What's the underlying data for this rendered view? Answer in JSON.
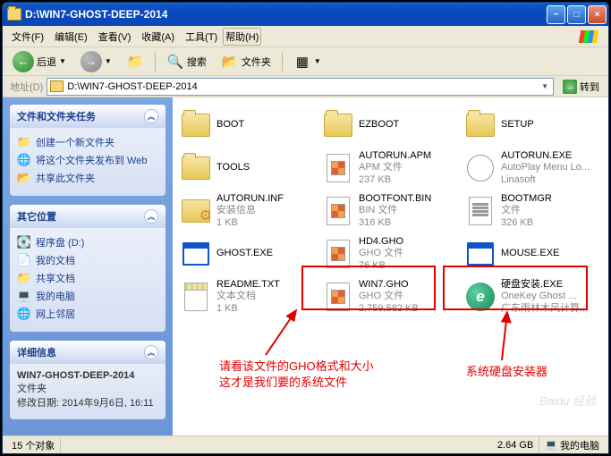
{
  "window": {
    "title": "D:\\WIN7-GHOST-DEEP-2014"
  },
  "menu": {
    "file": "文件(F)",
    "edit": "编辑(E)",
    "view": "查看(V)",
    "favorites": "收藏(A)",
    "tools": "工具(T)",
    "help": "帮助(H)"
  },
  "toolbar": {
    "back": "后退",
    "search": "搜索",
    "folders": "文件夹"
  },
  "address": {
    "label": "地址(D)",
    "value": "D:\\WIN7-GHOST-DEEP-2014",
    "go": "转到"
  },
  "sidebar": {
    "tasks": {
      "title": "文件和文件夹任务",
      "items": [
        {
          "label": "创建一个新文件夹"
        },
        {
          "label": "将这个文件夹发布到 Web"
        },
        {
          "label": "共享此文件夹"
        }
      ]
    },
    "places": {
      "title": "其它位置",
      "items": [
        {
          "label": "程序盘 (D:)"
        },
        {
          "label": "我的文档"
        },
        {
          "label": "共享文档"
        },
        {
          "label": "我的电脑"
        },
        {
          "label": "网上邻居"
        }
      ]
    },
    "details": {
      "title": "详细信息",
      "name": "WIN7-GHOST-DEEP-2014",
      "type": "文件夹",
      "modified_label": "修改日期:",
      "modified_value": "2014年9月6日, 16:11"
    }
  },
  "files": [
    {
      "name": "BOOT",
      "icon": "folder"
    },
    {
      "name": "EZBOOT",
      "icon": "folder"
    },
    {
      "name": "SETUP",
      "icon": "folder"
    },
    {
      "name": "TOOLS",
      "icon": "folder"
    },
    {
      "name": "AUTORUN.APM",
      "meta1": "APM 文件",
      "meta2": "237 KB",
      "icon": "gho"
    },
    {
      "name": "AUTORUN.EXE",
      "meta1": "AutoPlay Menu Lo...",
      "meta2": "Linasoft",
      "icon": "cd"
    },
    {
      "name": "AUTORUN.INF",
      "meta1": "安装信息",
      "meta2": "1 KB",
      "icon": "gear"
    },
    {
      "name": "BOOTFONT.BIN",
      "meta1": "BIN 文件",
      "meta2": "316 KB",
      "icon": "gho"
    },
    {
      "name": "BOOTMGR",
      "meta1": "文件",
      "meta2": "326 KB",
      "icon": "doc"
    },
    {
      "name": "GHOST.EXE",
      "icon": "exe"
    },
    {
      "name": "HD4.GHO",
      "meta1": "GHO 文件",
      "meta2": "76 KB",
      "icon": "gho"
    },
    {
      "name": "MOUSE.EXE",
      "icon": "exe"
    },
    {
      "name": "README.TXT",
      "meta1": "文本文档",
      "meta2": "1 KB",
      "icon": "txt"
    },
    {
      "name": "WIN7.GHO",
      "meta1": "GHO 文件",
      "meta2": "2,759,582 KB",
      "icon": "gho"
    },
    {
      "name": "硬盘安装.EXE",
      "meta1": "OneKey Ghost ...",
      "meta2": "广东雨林木风计算...",
      "icon": "oem"
    }
  ],
  "annotations": {
    "a1_line1": "请看该文件的GHO格式和大小",
    "a1_line2": "这才是我们要的系统文件",
    "a2": "系统硬盘安装器"
  },
  "statusbar": {
    "objects": "15 个对象",
    "size": "2.64 GB",
    "loc_icon": "💻",
    "loc": "我的电脑"
  },
  "watermark": "Baidu 经验"
}
